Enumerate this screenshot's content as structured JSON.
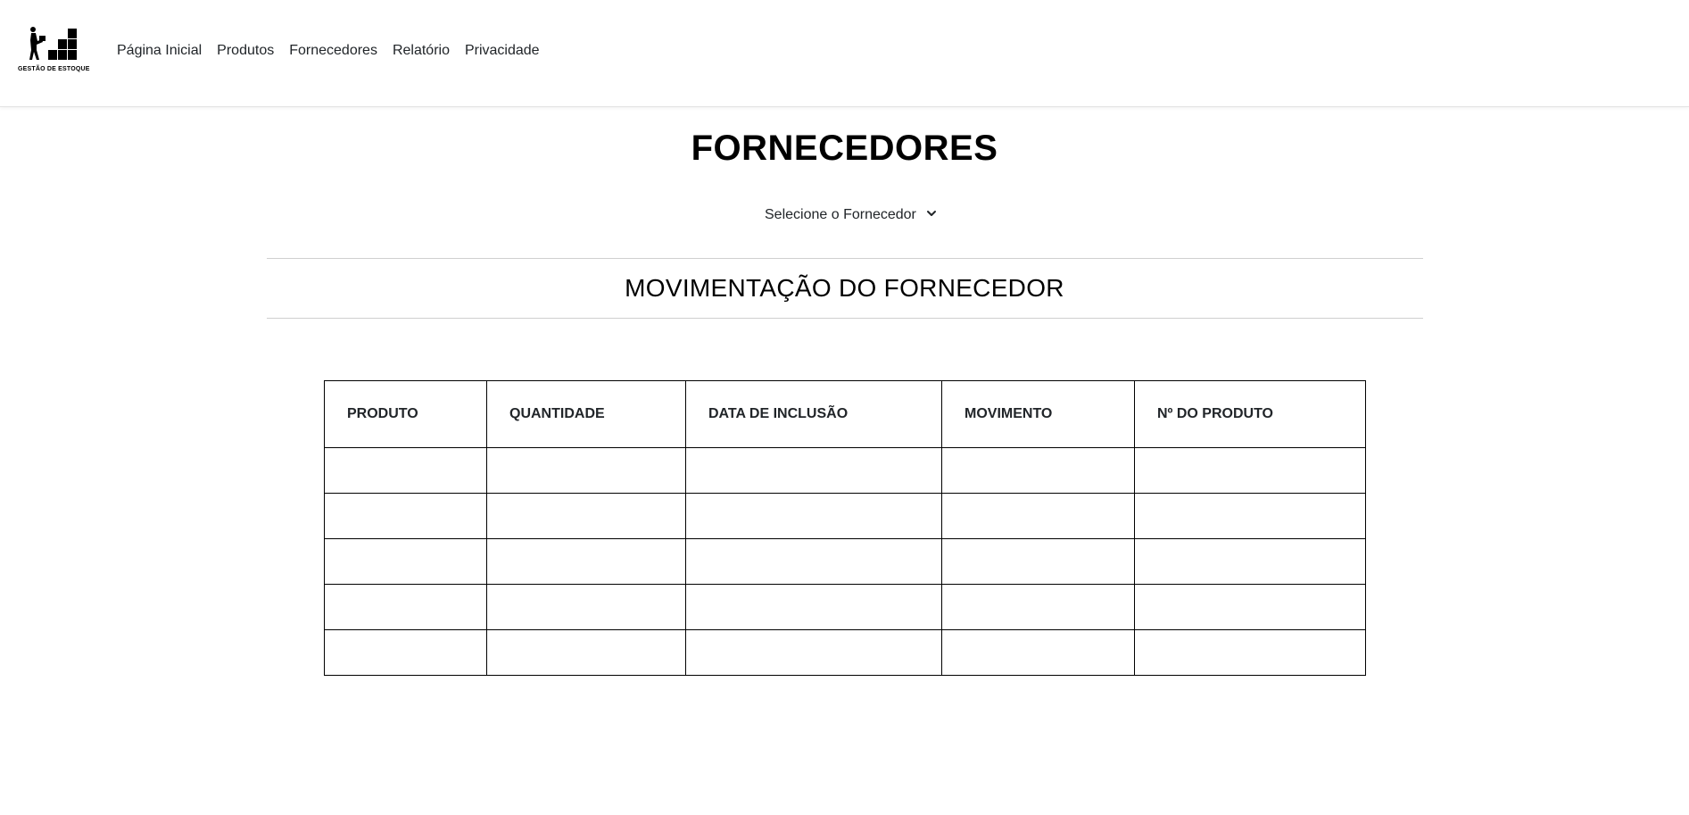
{
  "brand": {
    "logo_text": "GESTÃO DE ESTOQUE",
    "icon": "warehouse-worker-boxes-icon"
  },
  "nav": {
    "items": [
      {
        "label": "Página Inicial"
      },
      {
        "label": "Produtos"
      },
      {
        "label": "Fornecedores"
      },
      {
        "label": "Relatório"
      },
      {
        "label": "Privacidade"
      }
    ]
  },
  "page": {
    "title": "FORNECEDORES"
  },
  "supplier_select": {
    "selected_label": "Selecione o Fornecedor",
    "icon": "chevron-down-icon"
  },
  "section": {
    "title": "MOVIMENTAÇÃO DO FORNECEDOR"
  },
  "table": {
    "columns": [
      "PRODUTO",
      "QUANTIDADE",
      "DATA DE INCLUSÃO",
      "MOVIMENTO",
      "Nº DO PRODUTO"
    ],
    "rows": [
      [
        "",
        "",
        "",
        "",
        ""
      ],
      [
        "",
        "",
        "",
        "",
        ""
      ],
      [
        "",
        "",
        "",
        "",
        ""
      ],
      [
        "",
        "",
        "",
        "",
        ""
      ],
      [
        "",
        "",
        "",
        "",
        ""
      ]
    ]
  },
  "colors": {
    "text": "#212529",
    "title": "#000000",
    "border": "#000000",
    "divider": "#cfcfcf"
  }
}
